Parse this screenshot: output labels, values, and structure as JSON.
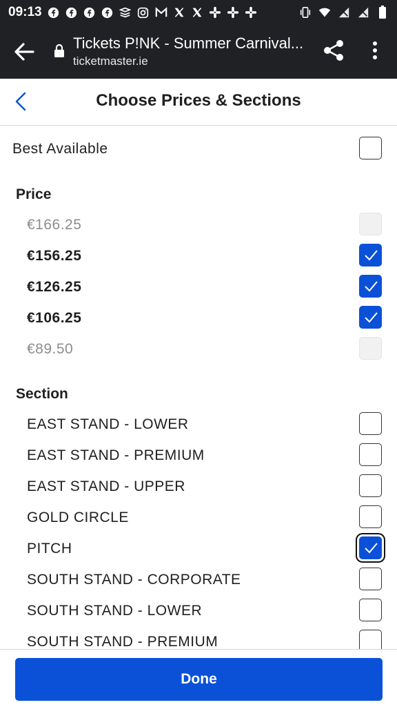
{
  "status_bar": {
    "time": "09:13",
    "notification_icons": [
      "facebook-icon",
      "facebook-icon",
      "facebook-icon",
      "facebook-icon",
      "stack-icon",
      "instagram-icon",
      "gmail-icon",
      "x-icon",
      "x-icon",
      "slack-icon",
      "slack-icon",
      "slack-icon"
    ],
    "system_icons": [
      "vibrate-icon",
      "wifi-icon",
      "signal-off-icon",
      "signal-off-icon",
      "battery-icon"
    ]
  },
  "browser": {
    "page_title": "Tickets P!NK - Summer Carnival...",
    "domain": "ticketmaster.ie"
  },
  "header": {
    "title": "Choose Prices & Sections"
  },
  "best_available": {
    "label": "Best Available",
    "checked": false
  },
  "price": {
    "heading": "Price",
    "options": [
      {
        "label": "€166.25",
        "state": "disabled"
      },
      {
        "label": "€156.25",
        "state": "checked"
      },
      {
        "label": "€126.25",
        "state": "checked"
      },
      {
        "label": "€106.25",
        "state": "checked"
      },
      {
        "label": "€89.50",
        "state": "disabled"
      }
    ]
  },
  "section": {
    "heading": "Section",
    "options": [
      {
        "label": "EAST STAND - LOWER",
        "state": "unchecked"
      },
      {
        "label": "EAST STAND - PREMIUM",
        "state": "unchecked"
      },
      {
        "label": "EAST STAND - UPPER",
        "state": "unchecked"
      },
      {
        "label": "GOLD CIRCLE",
        "state": "unchecked"
      },
      {
        "label": "PITCH",
        "state": "checked-focused"
      },
      {
        "label": "SOUTH STAND - CORPORATE",
        "state": "unchecked"
      },
      {
        "label": "SOUTH STAND - LOWER",
        "state": "unchecked"
      },
      {
        "label": "SOUTH STAND - PREMIUM",
        "state": "unchecked"
      }
    ]
  },
  "footer": {
    "done_label": "Done"
  },
  "colors": {
    "accent": "#0b51d8",
    "bar_background": "#202124",
    "disabled_text": "#8d8d8d"
  }
}
